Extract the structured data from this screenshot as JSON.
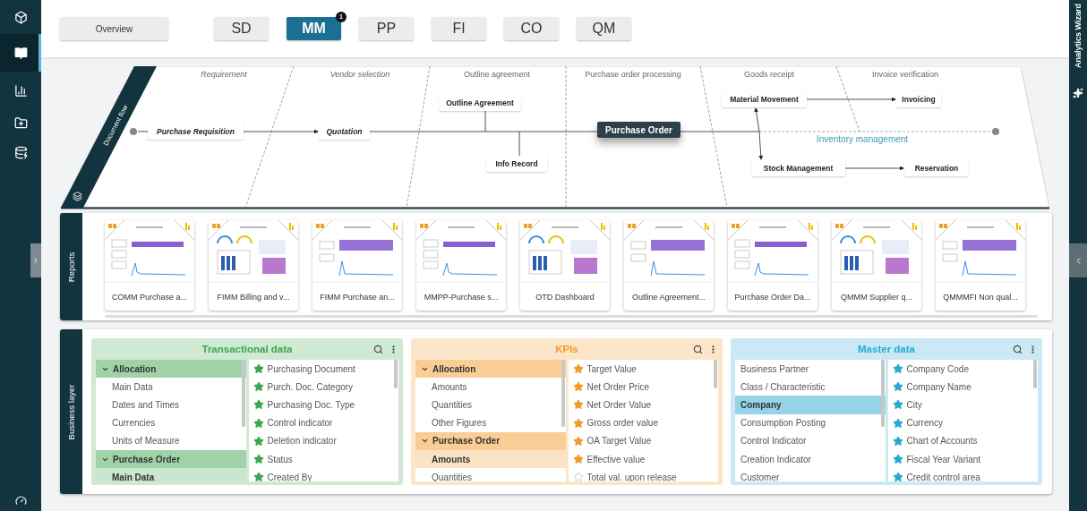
{
  "nav": [
    {
      "selected": false
    },
    {
      "selected": true
    },
    {
      "selected": false
    },
    {
      "selected": false
    },
    {
      "selected": false
    }
  ],
  "tabs": [
    {
      "label": "Overview",
      "selected": false
    },
    {
      "label": "SD",
      "selected": false
    },
    {
      "label": "MM",
      "selected": true,
      "badge": "1"
    },
    {
      "label": "PP",
      "selected": false
    },
    {
      "label": "FI",
      "selected": false
    },
    {
      "label": "CO",
      "selected": false
    },
    {
      "label": "QM",
      "selected": false
    }
  ],
  "document_flow": {
    "title": "Document flow",
    "lane_label": "Inventory management",
    "phases": [
      {
        "label": "Requirement",
        "inactive": true
      },
      {
        "label": "Vendor selection",
        "inactive": true
      },
      {
        "label": "Outline agreement",
        "inactive": false
      },
      {
        "label": "Purchase order processing",
        "inactive": false
      },
      {
        "label": "Goods receipt",
        "inactive": false
      },
      {
        "label": "Invoice verification",
        "inactive": false
      }
    ],
    "nodes": [
      {
        "label": "Purchase Requisition",
        "inactive": true,
        "selected": false
      },
      {
        "label": "Quotation",
        "inactive": true,
        "selected": false
      },
      {
        "label": "Outline Agreement",
        "inactive": false,
        "selected": false
      },
      {
        "label": "Info Record",
        "inactive": false,
        "selected": false
      },
      {
        "label": "Purchase Order",
        "inactive": false,
        "selected": true
      },
      {
        "label": "Material Movement",
        "inactive": false,
        "selected": false
      },
      {
        "label": "Invoicing",
        "inactive": false,
        "selected": false
      },
      {
        "label": "Stock Management",
        "inactive": false,
        "selected": false
      },
      {
        "label": "Reservation",
        "inactive": false,
        "selected": false
      }
    ]
  },
  "reports": {
    "title": "Reports",
    "items": [
      {
        "label": "COMM Purchase a..."
      },
      {
        "label": "FIMM Billing and v..."
      },
      {
        "label": "FIMM Purchase an..."
      },
      {
        "label": "MMPP-Purchase s..."
      },
      {
        "label": "OTD Dashboard"
      },
      {
        "label": "Outline Agreement..."
      },
      {
        "label": "Purchase Order Da..."
      },
      {
        "label": "QMMM Supplier q..."
      },
      {
        "label": "QMMMFI Non qual..."
      }
    ]
  },
  "business_layer": {
    "title": "Business layer",
    "panels": [
      {
        "title": "Transactional data",
        "color": "#3ea64f",
        "categories": [
          {
            "label": "Allocation",
            "expanded": true,
            "children": [
              {
                "label": "Main Data",
                "selected": false
              },
              {
                "label": "Dates and Times",
                "selected": false
              },
              {
                "label": "Currencies",
                "selected": false
              },
              {
                "label": "Units of Measure",
                "selected": false
              }
            ]
          },
          {
            "label": "Purchase Order",
            "expanded": true,
            "children": [
              {
                "label": "Main Data",
                "selected": true
              }
            ]
          }
        ],
        "fields": [
          {
            "label": "Purchasing Document",
            "starred": true
          },
          {
            "label": "Purch. Doc. Category",
            "starred": true
          },
          {
            "label": "Purchasing Doc. Type",
            "starred": true
          },
          {
            "label": "Control indicator",
            "starred": true
          },
          {
            "label": "Deletion indicator",
            "starred": true
          },
          {
            "label": "Status",
            "starred": true
          },
          {
            "label": "Created By",
            "starred": true
          }
        ]
      },
      {
        "title": "KPIs",
        "color": "#f39a2b",
        "categories": [
          {
            "label": "Allocation",
            "expanded": true,
            "children": [
              {
                "label": "Amounts",
                "selected": false
              },
              {
                "label": "Quantities",
                "selected": false
              },
              {
                "label": "Other Figures",
                "selected": false
              }
            ]
          },
          {
            "label": "Purchase Order",
            "expanded": true,
            "children": [
              {
                "label": "Amounts",
                "selected": true
              },
              {
                "label": "Quantities",
                "selected": false
              }
            ]
          }
        ],
        "fields": [
          {
            "label": "Target Value",
            "starred": true
          },
          {
            "label": "Net Order Price",
            "starred": true
          },
          {
            "label": "Net Order Value",
            "starred": true
          },
          {
            "label": "Gross order value",
            "starred": true
          },
          {
            "label": "OA Target Value",
            "starred": true
          },
          {
            "label": "Effective value",
            "starred": true
          },
          {
            "label": "Total val. upon release",
            "starred": false
          }
        ]
      },
      {
        "title": "Master data",
        "color": "#2aa7d1",
        "categories": [
          {
            "label": "Business Partner",
            "selected": false
          },
          {
            "label": "Class / Characteristic",
            "selected": false
          },
          {
            "label": "Company",
            "selected": true
          },
          {
            "label": "Consumption Posting",
            "selected": false
          },
          {
            "label": "Control Indicator",
            "selected": false
          },
          {
            "label": "Creation Indicator",
            "selected": false
          },
          {
            "label": "Customer",
            "selected": false
          }
        ],
        "fields": [
          {
            "label": "Company Code",
            "starred": true
          },
          {
            "label": "Company Name",
            "starred": true
          },
          {
            "label": "City",
            "starred": true
          },
          {
            "label": "Currency",
            "starred": true
          },
          {
            "label": "Chart of Accounts",
            "starred": true
          },
          {
            "label": "Fiscal Year Variant",
            "starred": true
          },
          {
            "label": "Credit control area",
            "starred": true
          }
        ]
      }
    ]
  },
  "wizard": {
    "title": "Analytics Wizard"
  }
}
